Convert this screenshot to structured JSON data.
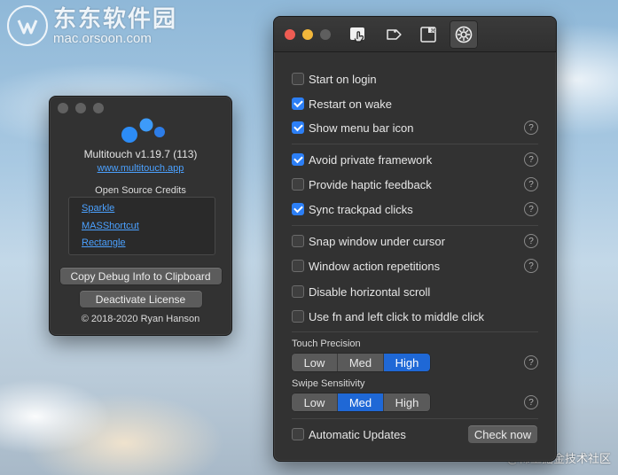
{
  "watermark": {
    "title": "东东软件园",
    "url": "mac.orsoon.com",
    "bottom_right": "@稀土掘金技术社区"
  },
  "about": {
    "title": "Multitouch v1.19.7 (113)",
    "website": "www.multitouch.app",
    "credits_label": "Open Source Credits",
    "credits": [
      "Sparkle",
      "MASShortcut",
      "Rectangle"
    ],
    "copy_debug_label": "Copy Debug Info to Clipboard",
    "deactivate_label": "Deactivate License",
    "copyright": "© 2018-2020 Ryan Hanson",
    "logo_colors": [
      "#2c8cf6",
      "#3d9bf9",
      "#2d7de8"
    ]
  },
  "prefs": {
    "toolbar": {
      "tabs": [
        {
          "icon": "gesture-icon",
          "active": false
        },
        {
          "icon": "tag-icon",
          "active": false
        },
        {
          "icon": "shortcut-window-icon",
          "active": false
        },
        {
          "icon": "gear-icon",
          "active": true
        }
      ]
    },
    "group1": [
      {
        "label": "Start on login",
        "checked": false,
        "help": false
      },
      {
        "label": "Restart on wake",
        "checked": true,
        "help": false
      },
      {
        "label": "Show menu bar icon",
        "checked": true,
        "help": true
      }
    ],
    "group2": [
      {
        "label": "Avoid private framework",
        "checked": true,
        "help": true
      },
      {
        "label": "Provide haptic feedback",
        "checked": false,
        "help": true
      },
      {
        "label": "Sync trackpad clicks",
        "checked": true,
        "help": true
      }
    ],
    "group3": [
      {
        "label": "Snap window under cursor",
        "checked": false,
        "help": true
      },
      {
        "label": "Window action repetitions",
        "checked": false,
        "help": true
      },
      {
        "label": "Disable horizontal scroll",
        "checked": false,
        "help": false
      },
      {
        "label": "Use fn and left click to middle click",
        "checked": false,
        "help": false
      }
    ],
    "touch_precision": {
      "label": "Touch Precision",
      "options": [
        "Low",
        "Med",
        "High"
      ],
      "selected": "High"
    },
    "swipe_sensitivity": {
      "label": "Swipe Sensitivity",
      "options": [
        "Low",
        "Med",
        "High"
      ],
      "selected": "Med"
    },
    "auto_updates": {
      "label": "Automatic Updates",
      "checked": false
    },
    "check_now_label": "Check now",
    "help_glyph": "?",
    "accent_color": "#2c7ff6"
  }
}
